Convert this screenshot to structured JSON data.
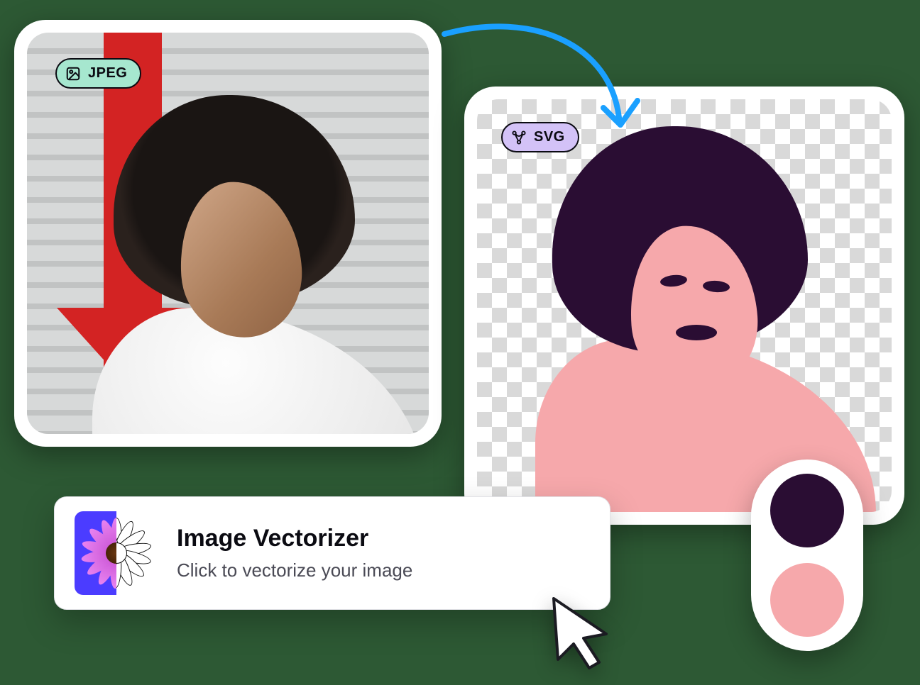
{
  "badges": {
    "jpeg": {
      "label": "JPEG",
      "icon": "image-icon"
    },
    "svg": {
      "label": "SVG",
      "icon": "vector-pen-icon"
    }
  },
  "arrow": {
    "color": "#1aa0ff"
  },
  "vectorizer": {
    "title": "Image Vectorizer",
    "subtitle": "Click to vectorize your image",
    "thumb_icon": "flower-half-vector-icon"
  },
  "palette": {
    "colors": [
      "#2a0d33",
      "#f6a8ab"
    ]
  },
  "cursor": {
    "icon": "pointer-cursor-icon"
  }
}
